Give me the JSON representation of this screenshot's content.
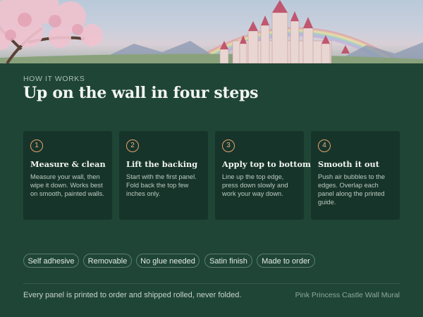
{
  "hero": {
    "image": "castle-cherry-blossom-rainbow-illustration"
  },
  "section": {
    "kicker": "HOW IT WORKS",
    "title": "Up on the wall in four steps"
  },
  "steps": [
    {
      "number": "1",
      "title": "Measure & clean",
      "body": "Measure your wall, then wipe it down. Works best on smooth, painted walls."
    },
    {
      "number": "2",
      "title": "Lift the backing",
      "body": "Start with the first panel. Fold back the top few inches only."
    },
    {
      "number": "3",
      "title": "Apply top to bottom",
      "body": "Line up the top edge, press down slowly and work your way down."
    },
    {
      "number": "4",
      "title": "Smooth it out",
      "body": "Push air bubbles to the edges. Overlap each panel along the printed guide."
    }
  ],
  "features": [
    "Self adhesive",
    "Removable",
    "No glue needed",
    "Satin finish",
    "Made to order"
  ],
  "footer": {
    "note": "Every panel is printed to order and shipped rolled, never folded.",
    "product": "Pink Princess Castle Wall Mural"
  },
  "colors": {
    "background": "#1f4536",
    "card": "#17342a",
    "accent": "#e5a46f"
  }
}
